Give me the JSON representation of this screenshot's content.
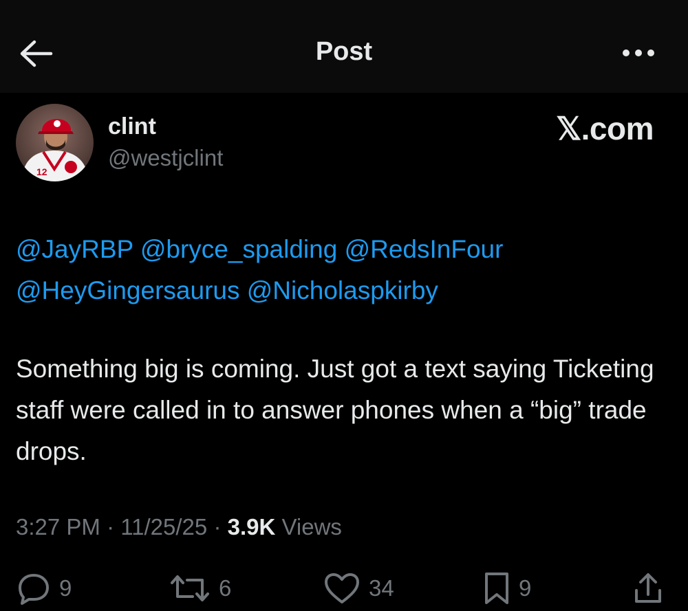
{
  "header": {
    "title": "Post",
    "back_icon": "arrow-left-icon",
    "more_icon": "more-horizontal-icon"
  },
  "author": {
    "display_name": "clint",
    "handle": "@westjclint",
    "avatar_jersey_number": "12"
  },
  "watermark": "𝕏.com",
  "post": {
    "mentions": [
      "@JayRBP",
      "@bryce_spalding",
      "@RedsInFour",
      "@HeyGingersaurus",
      "@Nicholaspkirby"
    ],
    "text": "Something big is coming. Just got a text saying Ticketing staff were called in to answer phones when a “big” trade drops."
  },
  "meta": {
    "time": "3:27 PM",
    "date": "11/25/25",
    "views_count": "3.9K",
    "views_label": "Views",
    "separator": "·"
  },
  "actions": {
    "replies": "9",
    "reposts": "6",
    "likes": "34",
    "bookmarks": "9"
  },
  "colors": {
    "background": "#000000",
    "header_background": "#0b0b0b",
    "text": "#e7e9ea",
    "secondary": "#71767b",
    "link": "#1d9bf0"
  }
}
